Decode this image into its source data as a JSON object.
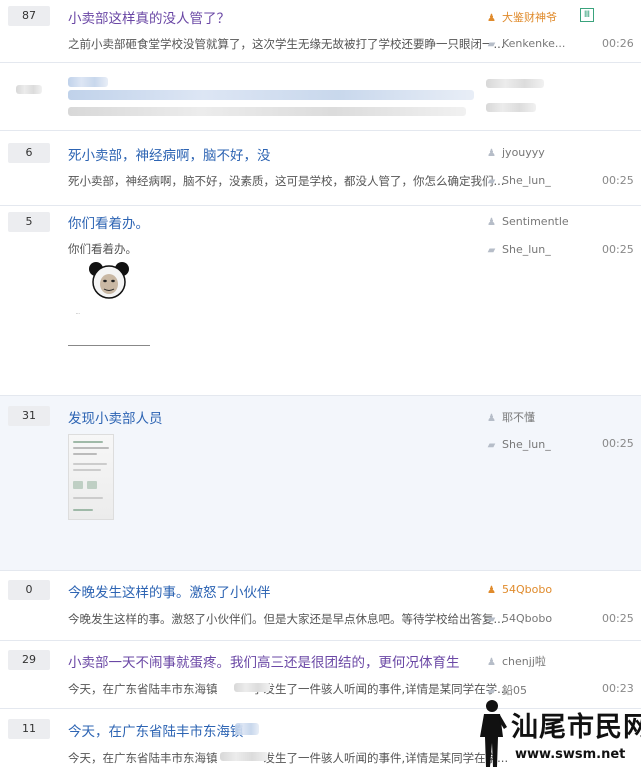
{
  "threads": [
    {
      "reply_count": "87",
      "title": "小卖部这样真的没人管了？",
      "abstract": "之前小卖部砸食堂学校没管就算了，这次学生无缘无故被打了学校还要睁一只眼闭一...",
      "author": "大鉴财神爷",
      "last_replier": "Kenkenke...",
      "time": "00:26",
      "badge": "Ⅲ"
    },
    {
      "reply_count": "",
      "title": "",
      "abstract": "",
      "author": "",
      "last_replier": "",
      "time": "",
      "blurred": true
    },
    {
      "reply_count": "6",
      "title": "死小卖部，神经病啊，脑不好，没",
      "abstract": "死小卖部，神经病啊，脑不好，没素质，这可是学校，都没人管了，你怎么确定我们...",
      "author": "jyouyyy",
      "last_replier": "She_lun_",
      "time": "00:25"
    },
    {
      "reply_count": "5",
      "title": "你们看着办。",
      "abstract": "你们看着办。",
      "author": "Sentimentle",
      "last_replier": "She_lun_",
      "time": "00:25",
      "meme_caption": "..."
    },
    {
      "reply_count": "31",
      "title": "发现小卖部人员",
      "abstract": "",
      "author": "耶不懂",
      "last_replier": "She_lun_",
      "time": "00:25"
    },
    {
      "reply_count": "0",
      "title": "今晚发生这样的事。激怒了小伙伴",
      "abstract": "今晚发生这样的事。激怒了小伙伴们。但是大家还是早点休息吧。等待学校给出答复...",
      "author": "54Qbobo",
      "last_replier": "54Qbobo",
      "time": "00:25"
    },
    {
      "reply_count": "29",
      "title": "小卖部一天不闹事就蛋疼。我们高三还是很团结的，更何况体育生",
      "abstract": "今天，在广东省陆丰市东海镇　　　学发生了一件骇人听闻的事件,详情是某同学在学...",
      "author": "chenjj啦",
      "last_replier": "鉛05",
      "time": "00:23"
    },
    {
      "reply_count": "11",
      "title": "今天，在广东省陆丰市东海镇",
      "abstract": "今天，在广东省陆丰市东海镇　　　　发生了一件骇人听闻的事件,详情是某同学在学...",
      "author": "",
      "last_replier": "",
      "time": ""
    }
  ],
  "watermark": {
    "title": "汕尾市民网",
    "url": "www.swsm.net"
  },
  "colors": {
    "title_blue": "#2d64b3",
    "title_purple": "#6a47a5",
    "author_orange": "#e08b2c",
    "highlight_bg": "#f3f6fb"
  }
}
